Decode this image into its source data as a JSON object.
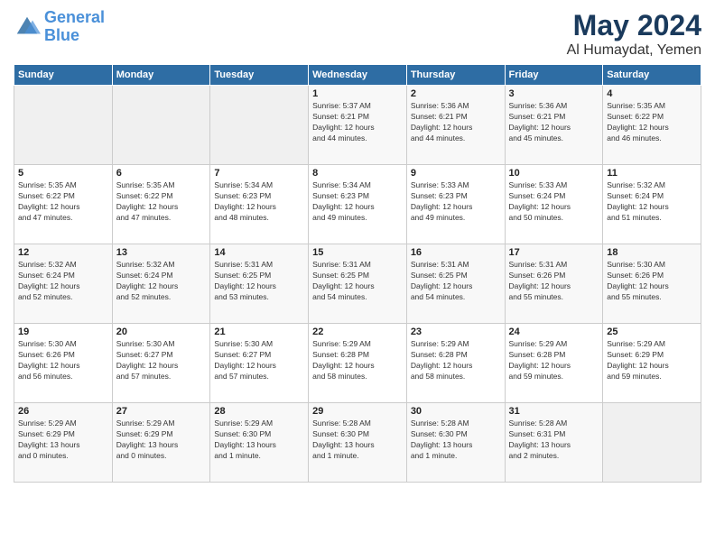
{
  "header": {
    "logo_line1": "General",
    "logo_line2": "Blue",
    "title": "May 2024",
    "subtitle": "Al Humaydat, Yemen"
  },
  "weekdays": [
    "Sunday",
    "Monday",
    "Tuesday",
    "Wednesday",
    "Thursday",
    "Friday",
    "Saturday"
  ],
  "weeks": [
    [
      {
        "day": "",
        "info": ""
      },
      {
        "day": "",
        "info": ""
      },
      {
        "day": "",
        "info": ""
      },
      {
        "day": "1",
        "info": "Sunrise: 5:37 AM\nSunset: 6:21 PM\nDaylight: 12 hours\nand 44 minutes."
      },
      {
        "day": "2",
        "info": "Sunrise: 5:36 AM\nSunset: 6:21 PM\nDaylight: 12 hours\nand 44 minutes."
      },
      {
        "day": "3",
        "info": "Sunrise: 5:36 AM\nSunset: 6:21 PM\nDaylight: 12 hours\nand 45 minutes."
      },
      {
        "day": "4",
        "info": "Sunrise: 5:35 AM\nSunset: 6:22 PM\nDaylight: 12 hours\nand 46 minutes."
      }
    ],
    [
      {
        "day": "5",
        "info": "Sunrise: 5:35 AM\nSunset: 6:22 PM\nDaylight: 12 hours\nand 47 minutes."
      },
      {
        "day": "6",
        "info": "Sunrise: 5:35 AM\nSunset: 6:22 PM\nDaylight: 12 hours\nand 47 minutes."
      },
      {
        "day": "7",
        "info": "Sunrise: 5:34 AM\nSunset: 6:23 PM\nDaylight: 12 hours\nand 48 minutes."
      },
      {
        "day": "8",
        "info": "Sunrise: 5:34 AM\nSunset: 6:23 PM\nDaylight: 12 hours\nand 49 minutes."
      },
      {
        "day": "9",
        "info": "Sunrise: 5:33 AM\nSunset: 6:23 PM\nDaylight: 12 hours\nand 49 minutes."
      },
      {
        "day": "10",
        "info": "Sunrise: 5:33 AM\nSunset: 6:24 PM\nDaylight: 12 hours\nand 50 minutes."
      },
      {
        "day": "11",
        "info": "Sunrise: 5:32 AM\nSunset: 6:24 PM\nDaylight: 12 hours\nand 51 minutes."
      }
    ],
    [
      {
        "day": "12",
        "info": "Sunrise: 5:32 AM\nSunset: 6:24 PM\nDaylight: 12 hours\nand 52 minutes."
      },
      {
        "day": "13",
        "info": "Sunrise: 5:32 AM\nSunset: 6:24 PM\nDaylight: 12 hours\nand 52 minutes."
      },
      {
        "day": "14",
        "info": "Sunrise: 5:31 AM\nSunset: 6:25 PM\nDaylight: 12 hours\nand 53 minutes."
      },
      {
        "day": "15",
        "info": "Sunrise: 5:31 AM\nSunset: 6:25 PM\nDaylight: 12 hours\nand 54 minutes."
      },
      {
        "day": "16",
        "info": "Sunrise: 5:31 AM\nSunset: 6:25 PM\nDaylight: 12 hours\nand 54 minutes."
      },
      {
        "day": "17",
        "info": "Sunrise: 5:31 AM\nSunset: 6:26 PM\nDaylight: 12 hours\nand 55 minutes."
      },
      {
        "day": "18",
        "info": "Sunrise: 5:30 AM\nSunset: 6:26 PM\nDaylight: 12 hours\nand 55 minutes."
      }
    ],
    [
      {
        "day": "19",
        "info": "Sunrise: 5:30 AM\nSunset: 6:26 PM\nDaylight: 12 hours\nand 56 minutes."
      },
      {
        "day": "20",
        "info": "Sunrise: 5:30 AM\nSunset: 6:27 PM\nDaylight: 12 hours\nand 57 minutes."
      },
      {
        "day": "21",
        "info": "Sunrise: 5:30 AM\nSunset: 6:27 PM\nDaylight: 12 hours\nand 57 minutes."
      },
      {
        "day": "22",
        "info": "Sunrise: 5:29 AM\nSunset: 6:28 PM\nDaylight: 12 hours\nand 58 minutes."
      },
      {
        "day": "23",
        "info": "Sunrise: 5:29 AM\nSunset: 6:28 PM\nDaylight: 12 hours\nand 58 minutes."
      },
      {
        "day": "24",
        "info": "Sunrise: 5:29 AM\nSunset: 6:28 PM\nDaylight: 12 hours\nand 59 minutes."
      },
      {
        "day": "25",
        "info": "Sunrise: 5:29 AM\nSunset: 6:29 PM\nDaylight: 12 hours\nand 59 minutes."
      }
    ],
    [
      {
        "day": "26",
        "info": "Sunrise: 5:29 AM\nSunset: 6:29 PM\nDaylight: 13 hours\nand 0 minutes."
      },
      {
        "day": "27",
        "info": "Sunrise: 5:29 AM\nSunset: 6:29 PM\nDaylight: 13 hours\nand 0 minutes."
      },
      {
        "day": "28",
        "info": "Sunrise: 5:29 AM\nSunset: 6:30 PM\nDaylight: 13 hours\nand 1 minute."
      },
      {
        "day": "29",
        "info": "Sunrise: 5:28 AM\nSunset: 6:30 PM\nDaylight: 13 hours\nand 1 minute."
      },
      {
        "day": "30",
        "info": "Sunrise: 5:28 AM\nSunset: 6:30 PM\nDaylight: 13 hours\nand 1 minute."
      },
      {
        "day": "31",
        "info": "Sunrise: 5:28 AM\nSunset: 6:31 PM\nDaylight: 13 hours\nand 2 minutes."
      },
      {
        "day": "",
        "info": ""
      }
    ]
  ]
}
